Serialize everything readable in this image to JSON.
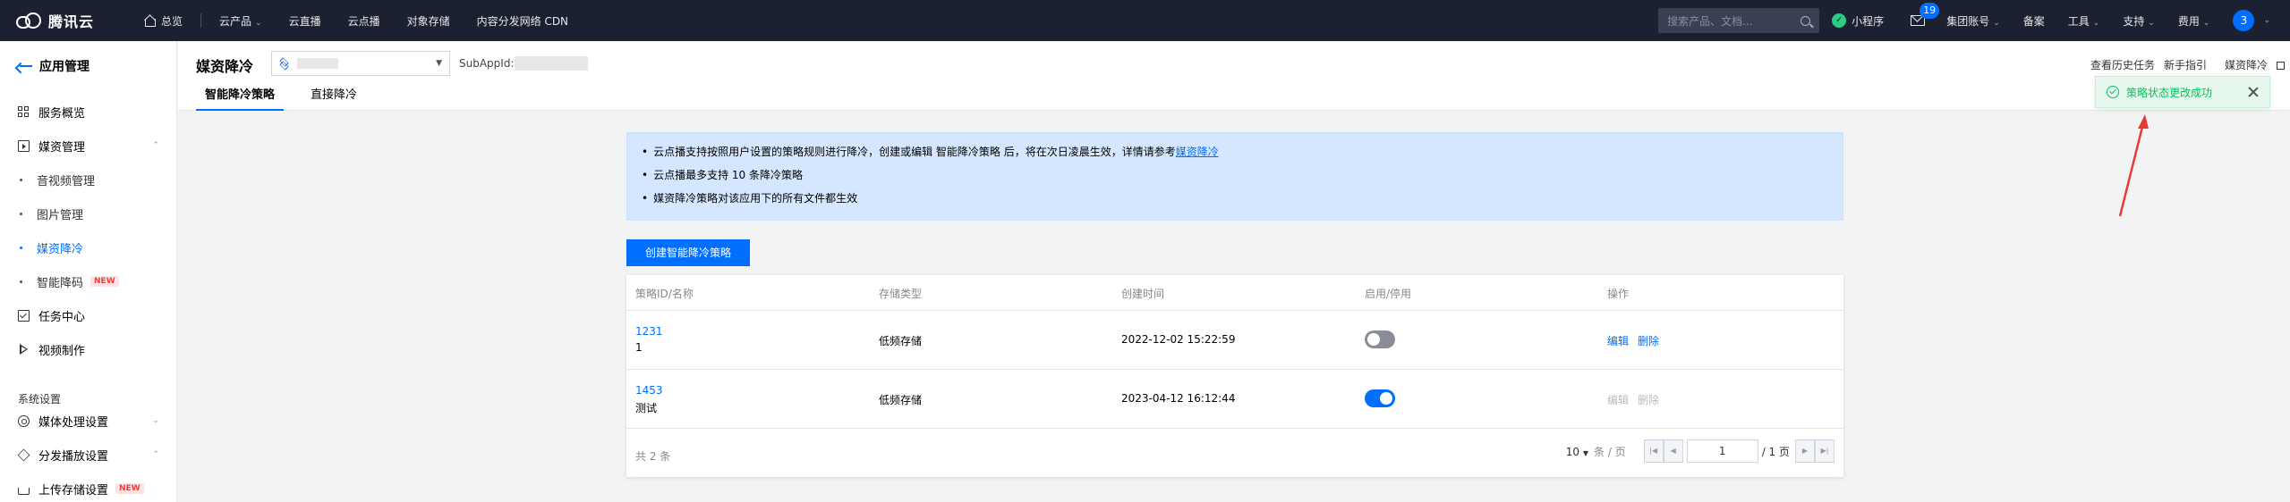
{
  "topbar": {
    "brand": "腾讯云",
    "home": "总览",
    "nav": [
      {
        "label": "云产品",
        "caret": true
      },
      {
        "label": "云直播",
        "caret": false
      },
      {
        "label": "云点播",
        "caret": false
      },
      {
        "label": "对象存储",
        "caret": false
      },
      {
        "label": "内容分发网络 CDN",
        "caret": false
      }
    ],
    "search_placeholder": "搜索产品、文档...",
    "mini_program": "小程序",
    "mail_badge": "19",
    "right_items": [
      {
        "label": "集团账号",
        "caret": true
      },
      {
        "label": "备案",
        "caret": false
      },
      {
        "label": "工具",
        "caret": true
      },
      {
        "label": "支持",
        "caret": true
      },
      {
        "label": "费用",
        "caret": true
      }
    ],
    "avatar_text": "3"
  },
  "sidebar": {
    "back_label": "应用管理",
    "items": [
      {
        "label": "服务概览",
        "icon": "grid-icon"
      },
      {
        "label": "媒资管理",
        "icon": "media-icon"
      },
      {
        "label": "音视频管理"
      },
      {
        "label": "图片管理"
      },
      {
        "label": "媒资降冷"
      },
      {
        "label": "智能降码",
        "badge": "NEW"
      },
      {
        "label": "任务中心",
        "icon": "task-icon"
      },
      {
        "label": "视频制作",
        "icon": "play-icon"
      },
      {
        "label": "媒体处理设置",
        "icon": "gear-icon"
      },
      {
        "label": "分发播放设置",
        "icon": "cube-icon"
      },
      {
        "label": "上传存储设置",
        "icon": "upload-icon",
        "badge": "NEW"
      }
    ],
    "section_label": "系统设置"
  },
  "header": {
    "title": "媒资降冷",
    "subappid_label": "SubAppId:",
    "tabs": [
      "智能降冷策略",
      "直接降冷"
    ],
    "right_links": [
      "查看历史任务",
      "新手指引",
      "媒资降冷"
    ]
  },
  "notice": {
    "line1_prefix": "云点播支持按照用户设置的策略规则进行降冷，创建或编辑 智能降冷策略 后，将在次日凌晨生效，详情请参考",
    "line1_link": "媒资降冷",
    "line2": "云点播最多支持 10 条降冷策略",
    "line3": "媒资降冷策略对该应用下的所有文件都生效"
  },
  "create_button": "创建智能降冷策略",
  "table": {
    "headers": [
      "策略ID/名称",
      "存储类型",
      "创建时间",
      "启用/停用",
      "操作"
    ],
    "rows": [
      {
        "id": "1231",
        "name": "1",
        "storage": "低频存储",
        "created": "2022-12-02 15:22:59",
        "enabled": false,
        "ops": [
          "编辑",
          "删除"
        ],
        "ops_disabled": false
      },
      {
        "id": "1453",
        "name": "测试",
        "storage": "低频存储",
        "created": "2023-04-12 16:12:44",
        "enabled": true,
        "ops": [
          "编辑",
          "删除"
        ],
        "ops_disabled": true
      }
    ],
    "total": "共 2 条",
    "page_size": "10",
    "page_size_unit": "条 / 页",
    "current_page": "1",
    "page_total": "/ 1 页"
  },
  "toast": {
    "message": "策略状态更改成功"
  },
  "colors": {
    "topbar": "#1c2131",
    "primary": "#006eff",
    "success": "#0abf5b",
    "annotation_arrow": "#e83a32"
  }
}
